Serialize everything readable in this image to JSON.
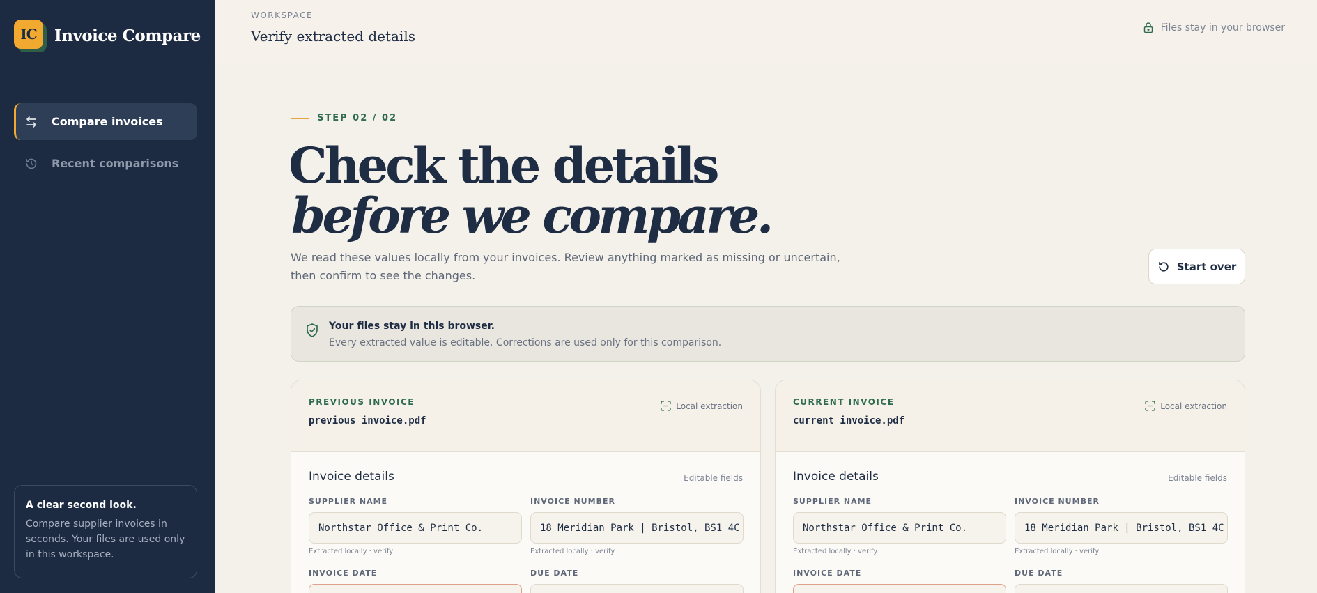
{
  "app": {
    "logo_text": "IC",
    "name": "Invoice Compare"
  },
  "sidebar": {
    "items": [
      {
        "label": "Compare invoices",
        "icon": "arrows-swap-icon",
        "active": true
      },
      {
        "label": "Recent comparisons",
        "icon": "history-icon",
        "active": false
      }
    ],
    "card": {
      "title": "A clear second look.",
      "text": "Compare supplier invoices in seconds. Your files are used only in this workspace."
    }
  },
  "topbar": {
    "kicker": "WORKSPACE",
    "title": "Verify extracted details",
    "privacy_note": "Files stay in your browser"
  },
  "hero": {
    "step": "STEP 02 / 02",
    "line1": "Check the details",
    "line2": "before we compare.",
    "lead": "We read these values locally from your invoices. Review anything marked as missing or uncertain, then confirm to see the changes.",
    "start_over": "Start over"
  },
  "banner": {
    "title": "Your files stay in this browser.",
    "text": "Every extracted value is editable. Corrections are used only for this comparison."
  },
  "invoices": {
    "previous": {
      "kicker": "PREVIOUS INVOICE",
      "file": "previous invoice.pdf",
      "badge": "Local extraction",
      "section": "Invoice details",
      "section_note": "Editable fields",
      "supplier_label": "SUPPLIER NAME",
      "supplier_value": "Northstar Office & Print Co.",
      "supplier_hint": "Extracted locally · verify",
      "number_label": "INVOICE NUMBER",
      "number_value": "18 Meridian Park | Bristol, BS1 4C",
      "number_hint": "Extracted locally · verify",
      "date_label": "INVOICE DATE",
      "due_label": "DUE DATE"
    },
    "current": {
      "kicker": "CURRENT INVOICE",
      "file": "current invoice.pdf",
      "badge": "Local extraction",
      "section": "Invoice details",
      "section_note": "Editable fields",
      "supplier_label": "SUPPLIER NAME",
      "supplier_value": "Northstar Office & Print Co.",
      "supplier_hint": "Extracted locally · verify",
      "number_label": "INVOICE NUMBER",
      "number_value": "18 Meridian Park | Bristol, BS1 4C",
      "number_hint": "Extracted locally · verify",
      "date_label": "INVOICE DATE",
      "due_label": "DUE DATE"
    }
  },
  "colors": {
    "sidebar_bg": "#1d2b42",
    "accent": "#f2a930",
    "brand_green": "#2f6b4e",
    "page_bg": "#f4f1ea",
    "warn_border": "#e0a08a"
  }
}
